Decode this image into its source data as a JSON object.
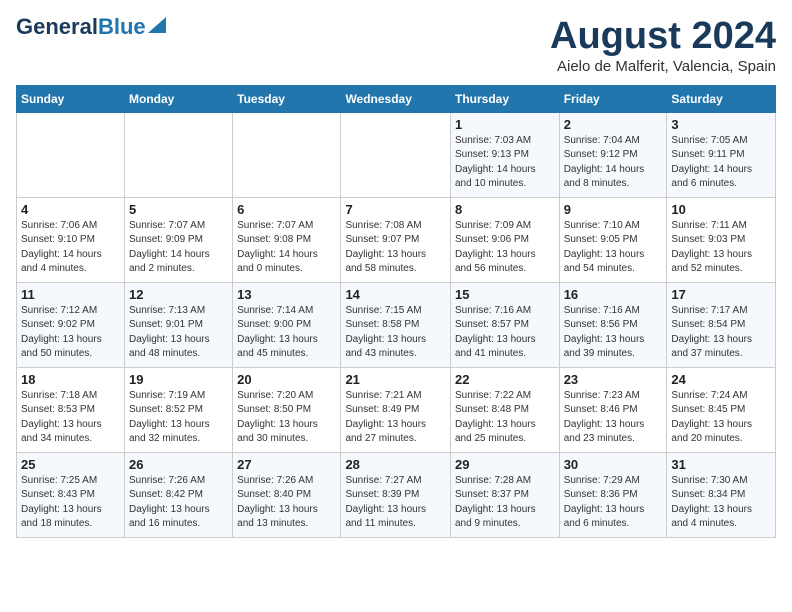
{
  "header": {
    "logo_general": "General",
    "logo_blue": "Blue",
    "month_year": "August 2024",
    "location": "Aielo de Malferit, Valencia, Spain"
  },
  "days_of_week": [
    "Sunday",
    "Monday",
    "Tuesday",
    "Wednesday",
    "Thursday",
    "Friday",
    "Saturday"
  ],
  "weeks": [
    [
      {
        "day": "",
        "info": ""
      },
      {
        "day": "",
        "info": ""
      },
      {
        "day": "",
        "info": ""
      },
      {
        "day": "",
        "info": ""
      },
      {
        "day": "1",
        "info": "Sunrise: 7:03 AM\nSunset: 9:13 PM\nDaylight: 14 hours\nand 10 minutes."
      },
      {
        "day": "2",
        "info": "Sunrise: 7:04 AM\nSunset: 9:12 PM\nDaylight: 14 hours\nand 8 minutes."
      },
      {
        "day": "3",
        "info": "Sunrise: 7:05 AM\nSunset: 9:11 PM\nDaylight: 14 hours\nand 6 minutes."
      }
    ],
    [
      {
        "day": "4",
        "info": "Sunrise: 7:06 AM\nSunset: 9:10 PM\nDaylight: 14 hours\nand 4 minutes."
      },
      {
        "day": "5",
        "info": "Sunrise: 7:07 AM\nSunset: 9:09 PM\nDaylight: 14 hours\nand 2 minutes."
      },
      {
        "day": "6",
        "info": "Sunrise: 7:07 AM\nSunset: 9:08 PM\nDaylight: 14 hours\nand 0 minutes."
      },
      {
        "day": "7",
        "info": "Sunrise: 7:08 AM\nSunset: 9:07 PM\nDaylight: 13 hours\nand 58 minutes."
      },
      {
        "day": "8",
        "info": "Sunrise: 7:09 AM\nSunset: 9:06 PM\nDaylight: 13 hours\nand 56 minutes."
      },
      {
        "day": "9",
        "info": "Sunrise: 7:10 AM\nSunset: 9:05 PM\nDaylight: 13 hours\nand 54 minutes."
      },
      {
        "day": "10",
        "info": "Sunrise: 7:11 AM\nSunset: 9:03 PM\nDaylight: 13 hours\nand 52 minutes."
      }
    ],
    [
      {
        "day": "11",
        "info": "Sunrise: 7:12 AM\nSunset: 9:02 PM\nDaylight: 13 hours\nand 50 minutes."
      },
      {
        "day": "12",
        "info": "Sunrise: 7:13 AM\nSunset: 9:01 PM\nDaylight: 13 hours\nand 48 minutes."
      },
      {
        "day": "13",
        "info": "Sunrise: 7:14 AM\nSunset: 9:00 PM\nDaylight: 13 hours\nand 45 minutes."
      },
      {
        "day": "14",
        "info": "Sunrise: 7:15 AM\nSunset: 8:58 PM\nDaylight: 13 hours\nand 43 minutes."
      },
      {
        "day": "15",
        "info": "Sunrise: 7:16 AM\nSunset: 8:57 PM\nDaylight: 13 hours\nand 41 minutes."
      },
      {
        "day": "16",
        "info": "Sunrise: 7:16 AM\nSunset: 8:56 PM\nDaylight: 13 hours\nand 39 minutes."
      },
      {
        "day": "17",
        "info": "Sunrise: 7:17 AM\nSunset: 8:54 PM\nDaylight: 13 hours\nand 37 minutes."
      }
    ],
    [
      {
        "day": "18",
        "info": "Sunrise: 7:18 AM\nSunset: 8:53 PM\nDaylight: 13 hours\nand 34 minutes."
      },
      {
        "day": "19",
        "info": "Sunrise: 7:19 AM\nSunset: 8:52 PM\nDaylight: 13 hours\nand 32 minutes."
      },
      {
        "day": "20",
        "info": "Sunrise: 7:20 AM\nSunset: 8:50 PM\nDaylight: 13 hours\nand 30 minutes."
      },
      {
        "day": "21",
        "info": "Sunrise: 7:21 AM\nSunset: 8:49 PM\nDaylight: 13 hours\nand 27 minutes."
      },
      {
        "day": "22",
        "info": "Sunrise: 7:22 AM\nSunset: 8:48 PM\nDaylight: 13 hours\nand 25 minutes."
      },
      {
        "day": "23",
        "info": "Sunrise: 7:23 AM\nSunset: 8:46 PM\nDaylight: 13 hours\nand 23 minutes."
      },
      {
        "day": "24",
        "info": "Sunrise: 7:24 AM\nSunset: 8:45 PM\nDaylight: 13 hours\nand 20 minutes."
      }
    ],
    [
      {
        "day": "25",
        "info": "Sunrise: 7:25 AM\nSunset: 8:43 PM\nDaylight: 13 hours\nand 18 minutes."
      },
      {
        "day": "26",
        "info": "Sunrise: 7:26 AM\nSunset: 8:42 PM\nDaylight: 13 hours\nand 16 minutes."
      },
      {
        "day": "27",
        "info": "Sunrise: 7:26 AM\nSunset: 8:40 PM\nDaylight: 13 hours\nand 13 minutes."
      },
      {
        "day": "28",
        "info": "Sunrise: 7:27 AM\nSunset: 8:39 PM\nDaylight: 13 hours\nand 11 minutes."
      },
      {
        "day": "29",
        "info": "Sunrise: 7:28 AM\nSunset: 8:37 PM\nDaylight: 13 hours\nand 9 minutes."
      },
      {
        "day": "30",
        "info": "Sunrise: 7:29 AM\nSunset: 8:36 PM\nDaylight: 13 hours\nand 6 minutes."
      },
      {
        "day": "31",
        "info": "Sunrise: 7:30 AM\nSunset: 8:34 PM\nDaylight: 13 hours\nand 4 minutes."
      }
    ]
  ]
}
